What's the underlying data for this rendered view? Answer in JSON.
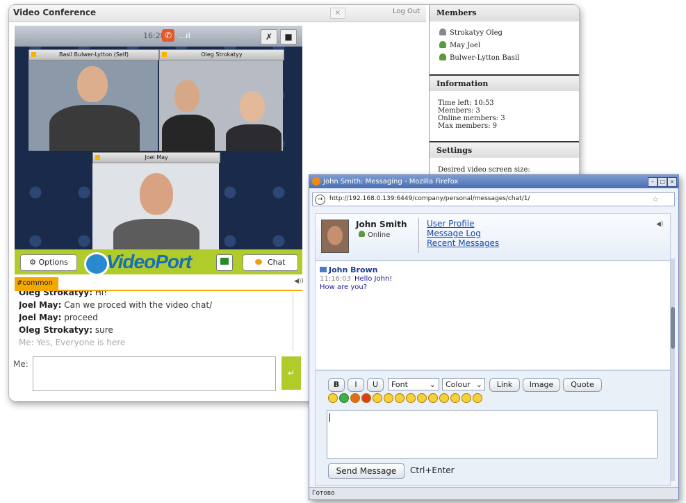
{
  "video_conference": {
    "title": "Video Conference",
    "close_label": "×",
    "logout_label": "Log Out",
    "clock": "16:28",
    "signal": "....ıll",
    "participants": {
      "self": "Basil Bulwer-Lytton (Self)",
      "p2": "Oleg Strokatyy",
      "p3": "Joel May"
    },
    "options_label": "Options",
    "logo_text": "VideoPort",
    "chat_label": "Chat",
    "channel_tab": "#common",
    "chat_lines": [
      {
        "author": "Oleg Strokatyy:",
        "text": " Hi!"
      },
      {
        "author": "Joel May:",
        "text": " Can we proced with the video chat/"
      },
      {
        "author": "Joel May:",
        "text": " proceed"
      },
      {
        "author": "Oleg Strokatyy:",
        "text": " sure"
      },
      {
        "author": "Me:",
        "text": " Yes, Everyone is here"
      }
    ],
    "me_label": "Me:",
    "send_icon": "↵"
  },
  "sidebar": {
    "members_header": "Members",
    "members": [
      "Strokatyy Oleg",
      "May Joel",
      "Bulwer-Lytton Basil"
    ],
    "info_header": "Information",
    "info_lines": [
      "Time left: 10:53",
      "Members: 3",
      "Online members: 3",
      "Max members: 9"
    ],
    "settings_header": "Settings",
    "settings_text": "Desired video screen size:"
  },
  "firefox": {
    "title": "John Smith: Messaging - Mozilla Firefox",
    "url": "http://192.168.0.139:6449/company/personal/messages/chat/1/",
    "profile": {
      "name": "John Smith",
      "status": "Online",
      "links": [
        "User Profile",
        "Message Log",
        "Recent Messages"
      ]
    },
    "message": {
      "from": "John Brown",
      "time": "11:16:03",
      "line1": "Hello John!",
      "line2": "How are you?"
    },
    "toolbar": {
      "bold": "B",
      "italic": "I",
      "underline": "U",
      "font": "Font",
      "colour": "Colour",
      "link": "Link",
      "image": "Image",
      "quote": "Quote"
    },
    "send_label": "Send Message",
    "hint": "Ctrl+Enter",
    "status": "Готово"
  },
  "colors": {
    "accent_green": "#b0cc2a",
    "channel_orange": "#f5a800",
    "link_blue": "#1a4aa8"
  }
}
